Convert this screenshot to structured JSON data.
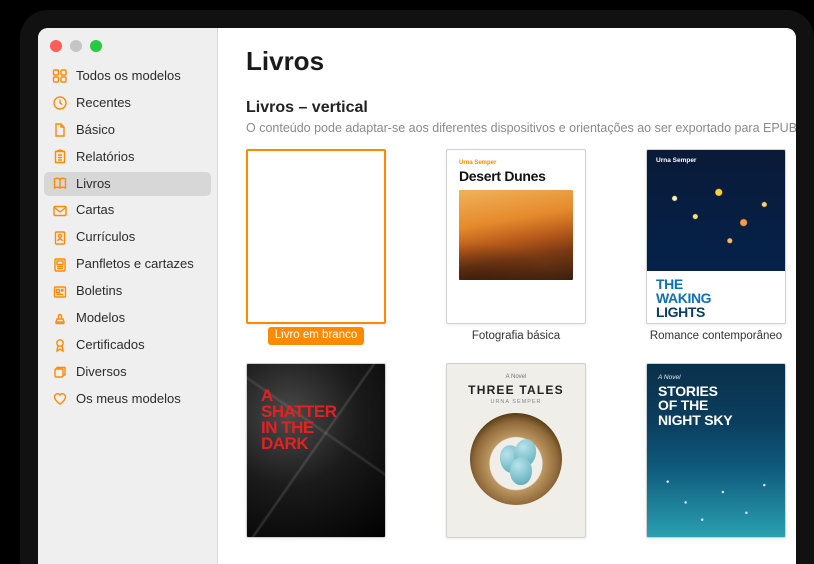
{
  "sidebar": {
    "items": [
      {
        "label": "Todos os modelos",
        "icon": "grid-icon"
      },
      {
        "label": "Recentes",
        "icon": "clock-icon"
      },
      {
        "label": "Básico",
        "icon": "document-icon"
      },
      {
        "label": "Relatórios",
        "icon": "report-icon"
      },
      {
        "label": "Livros",
        "icon": "book-icon",
        "selected": true
      },
      {
        "label": "Cartas",
        "icon": "envelope-icon"
      },
      {
        "label": "Currículos",
        "icon": "resume-icon"
      },
      {
        "label": "Panfletos e cartazes",
        "icon": "flyer-icon"
      },
      {
        "label": "Boletins",
        "icon": "newsletter-icon"
      },
      {
        "label": "Modelos",
        "icon": "stamp-icon"
      },
      {
        "label": "Certificados",
        "icon": "ribbon-icon"
      },
      {
        "label": "Diversos",
        "icon": "stack-icon"
      },
      {
        "label": "Os meus modelos",
        "icon": "heart-icon"
      }
    ]
  },
  "main": {
    "title": "Livros",
    "section_title": "Livros – vertical",
    "section_desc": "O conteúdo pode adaptar-se aos diferentes dispositivos e orientações ao ser exportado para EPUB. Melh",
    "templates": [
      {
        "label": "Livro em branco",
        "selected": true
      },
      {
        "label": "Fotografia básica"
      },
      {
        "label": "Romance contemporâneo"
      }
    ],
    "covers": {
      "desert": {
        "author": "Urna Semper",
        "title": "Desert Dunes"
      },
      "waking": {
        "author": "Urna Semper",
        "line1": "THE",
        "line2": "WAKING",
        "line3": "LIGHTS"
      },
      "shatter": {
        "w1": "A",
        "w2": "SHATTER",
        "w3": "IN THE",
        "w4": "DARK"
      },
      "three": {
        "sub": "A Novel",
        "title": "THREE TALES",
        "author": "URNA SEMPER"
      },
      "night": {
        "sub": "A Novel",
        "line1": "STORIES",
        "line2": "OF THE",
        "line3": "NIGHT SKY"
      }
    }
  }
}
